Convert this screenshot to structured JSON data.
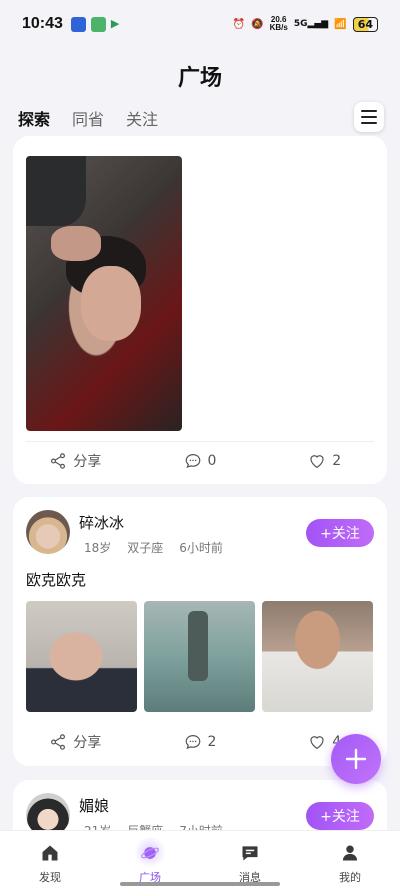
{
  "status_bar": {
    "time": "10:43",
    "network_speed": "20.6",
    "network_unit": "KB/s",
    "signal_label": "5G",
    "battery": "64"
  },
  "header": {
    "title": "广场",
    "tabs": [
      {
        "label": "探索",
        "active": true
      },
      {
        "label": "同省",
        "active": false
      },
      {
        "label": "关注",
        "active": false
      }
    ]
  },
  "posts": [
    {
      "actions": {
        "share_label": "分享",
        "comments": "0",
        "likes": "2"
      }
    },
    {
      "username": "碎冰冰",
      "age": "18岁",
      "zodiac": "双子座",
      "time": "6小时前",
      "follow_label": "+关注",
      "text": "欧克欧克",
      "actions": {
        "share_label": "分享",
        "comments": "2",
        "likes": "4"
      }
    },
    {
      "username": "媚娘",
      "age": "21岁",
      "zodiac": "巨蟹座",
      "time": "7小时前",
      "follow_label": "+关注"
    }
  ],
  "bottom_nav": [
    {
      "label": "发现",
      "icon": "home-icon",
      "active": false
    },
    {
      "label": "广场",
      "icon": "planet-icon",
      "active": true
    },
    {
      "label": "消息",
      "icon": "message-icon",
      "active": false
    },
    {
      "label": "我的",
      "icon": "profile-icon",
      "active": false
    }
  ],
  "colors": {
    "accent": "#a253f6",
    "background": "#f4f3f8"
  }
}
